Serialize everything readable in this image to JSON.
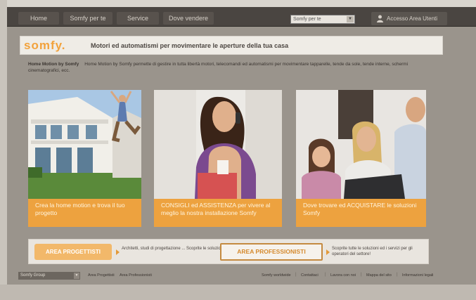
{
  "nav": {
    "items": [
      "Home",
      "Somfy per te",
      "Service",
      "Dove vendere"
    ],
    "profile_select": "Somfy per te",
    "login_label": "Accesso Area Utenti"
  },
  "banner": {
    "logo": "somfy.",
    "title": "Motori ed automatismi per movimentare le aperture della tua casa"
  },
  "intro": {
    "lead": "Home Motion by Somfy",
    "text": "Home Motion by Somfy permette di gestire in tutta libertà motori, telecomandi ed automatismi per movimentare tapparelle, tende da sole, tende interne, schermi cinematografici, ecc."
  },
  "cards": [
    {
      "caption": "Crea la home motion e trova il tuo progetto"
    },
    {
      "caption": "CONSIGLI ed ASSISTENZA per vivere al meglio la nostra installazione Somfy"
    },
    {
      "caption": "Dove trovare ed ACQUISTARE le soluzioni Somfy"
    }
  ],
  "cta": {
    "projects_label": "AREA PROGETTISTI",
    "projects_text": "Architetti, studi di progettazione ... Scoprite le soluzioni Somfy!",
    "pro_label": "AREA PROFESSIONISTI",
    "pro_text": "Scoprite tutte le soluzioni ed i servizi per gli operatori del settore!"
  },
  "footer": {
    "select_label": "Somfy Group",
    "links_left": [
      "Area Progettisti",
      "Area Professionisti"
    ],
    "links_right": [
      "Somfy worldwide",
      "Contattaci",
      "Lavora con noi",
      "Mappa del sito",
      "Informazioni legali"
    ]
  },
  "colors": {
    "accent_orange": "#eda23f",
    "nav_bg": "#4a4541",
    "banner_bg": "#efece6"
  }
}
